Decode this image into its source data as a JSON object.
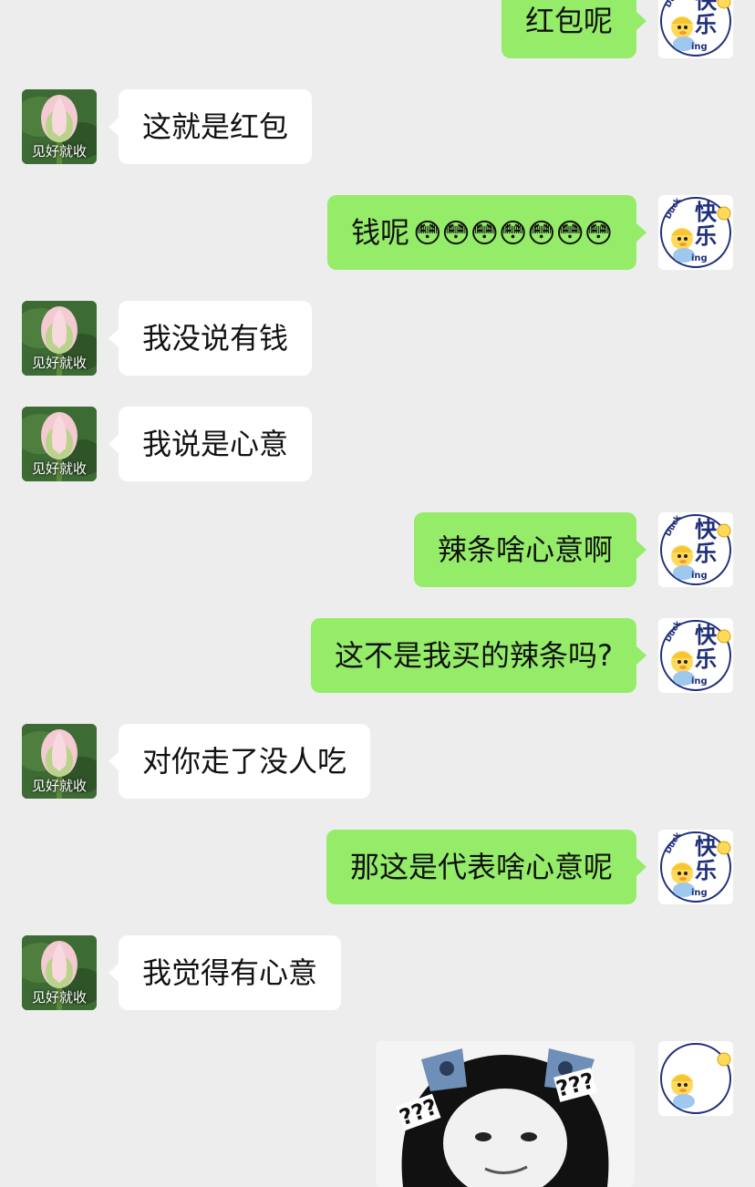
{
  "contacts": {
    "left_avatar_caption": "见好就收",
    "right_avatar_label_top": "Duck",
    "right_avatar_label_main": "快乐",
    "right_avatar_label_small": "ing"
  },
  "messages": [
    {
      "side": "right",
      "text": "红包呢"
    },
    {
      "side": "left",
      "text": "这就是红包"
    },
    {
      "side": "right",
      "text": "钱呢",
      "emoji": "😳😳😳😳😳😳😳"
    },
    {
      "side": "left",
      "text": "我没说有钱"
    },
    {
      "side": "left",
      "text": "我说是心意"
    },
    {
      "side": "right",
      "text": "辣条啥心意啊"
    },
    {
      "side": "right",
      "text": "这不是我买的辣条吗?"
    },
    {
      "side": "left",
      "text": "对你走了没人吃"
    },
    {
      "side": "right",
      "text": "那这是代表啥心意呢"
    },
    {
      "side": "left",
      "text": "我觉得有心意"
    }
  ],
  "sticker": {
    "question_marks": "???"
  },
  "colors": {
    "background": "#EDEDED",
    "self_bubble": "#95EC69",
    "other_bubble": "#FFFFFF"
  }
}
